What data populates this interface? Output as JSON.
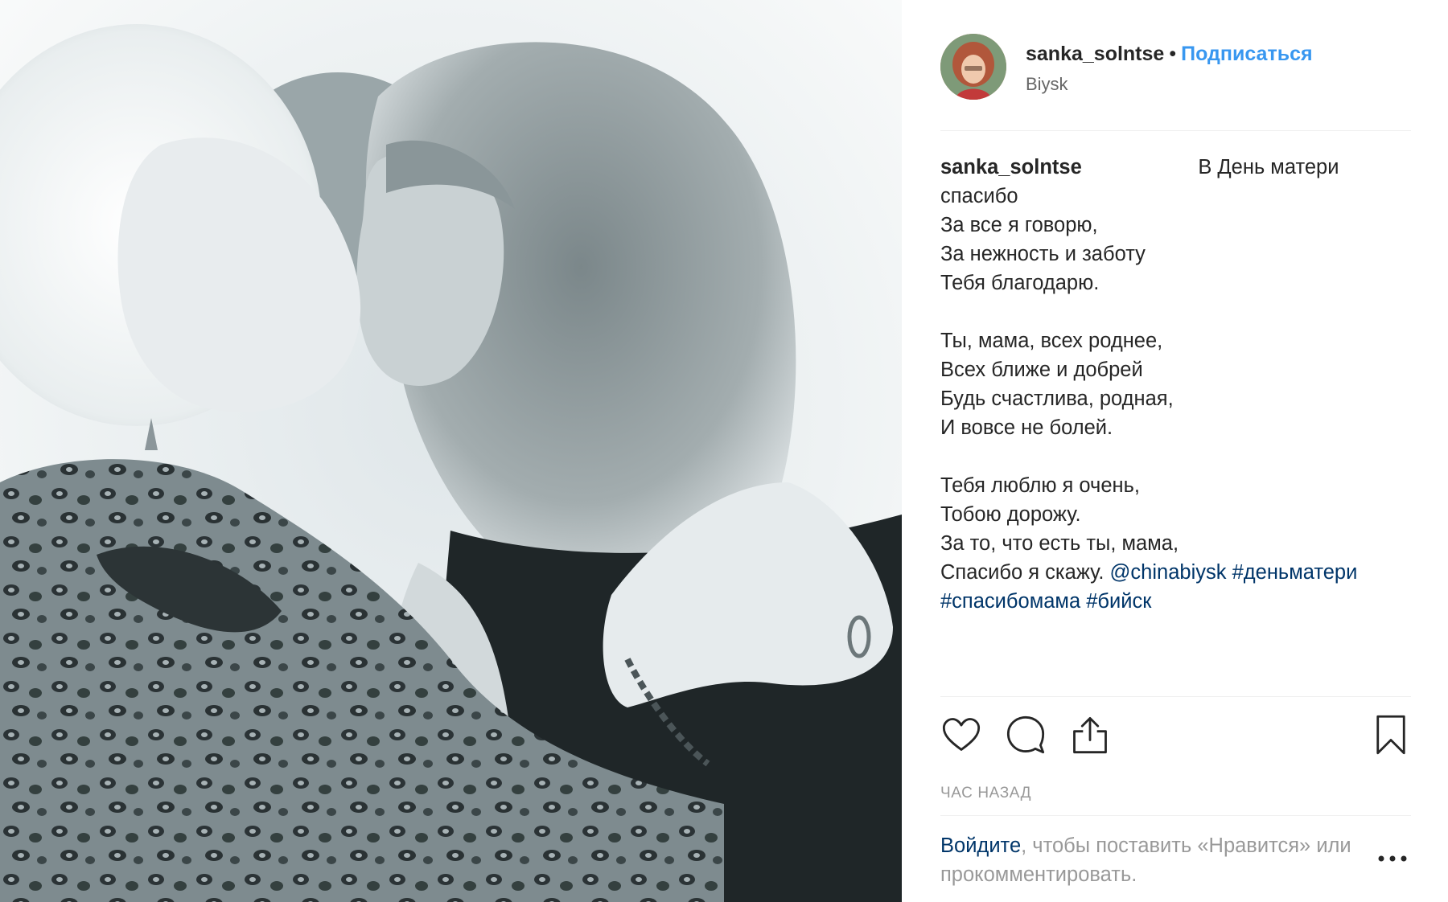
{
  "post": {
    "image_alt_icon": "photo-two-women-kissing",
    "header": {
      "username": "sanka_solntse",
      "separator": "•",
      "follow_label": "Подписаться",
      "location": "Biysk"
    },
    "caption": {
      "author": "sanka_solntse",
      "filler": "⁣ ⁣ ⁣ ⁣ ⁣ ⁣ ⁣ ⁣ ⁣ ⁣ ⁣ ⁣ ⁣ ⁣ ⁣ ⁣ ⁣ ⁣",
      "first_line_text": "В День матери",
      "lines": [
        "спасибо",
        "За все я говорю,",
        "За нежность и заботу",
        "Тебя благодарю.",
        "",
        "Ты, мама, всех роднее,",
        "Всех ближе и добрей",
        "Будь счастлива, родная,",
        "И вовсе не болей.",
        "",
        "Тебя люблю я очень,",
        "Тобою дорожу.",
        "За то, что есть ты, мама,"
      ],
      "last_line_text": "Спасибо я скажу.",
      "mention": "@chinabiysk",
      "hashtag_1": "#деньматери",
      "hashtag_2": "#спасибомама",
      "hashtag_3": "#бийск"
    },
    "actions": {
      "like_icon": "heart-icon",
      "comment_icon": "comment-icon",
      "share_icon": "share-icon",
      "save_icon": "bookmark-icon"
    },
    "timestamp": "ЧАС НАЗАД",
    "login_prompt": {
      "link_label": "Войдите",
      "rest_text": ", чтобы поставить «Нравится» или прокомментировать."
    },
    "more_options_icon": "more-dots-icon"
  },
  "colors": {
    "follow_blue": "#3897f0",
    "link_dark_blue": "#003569",
    "text": "#262626",
    "muted": "#999999",
    "divider": "#efefef"
  }
}
